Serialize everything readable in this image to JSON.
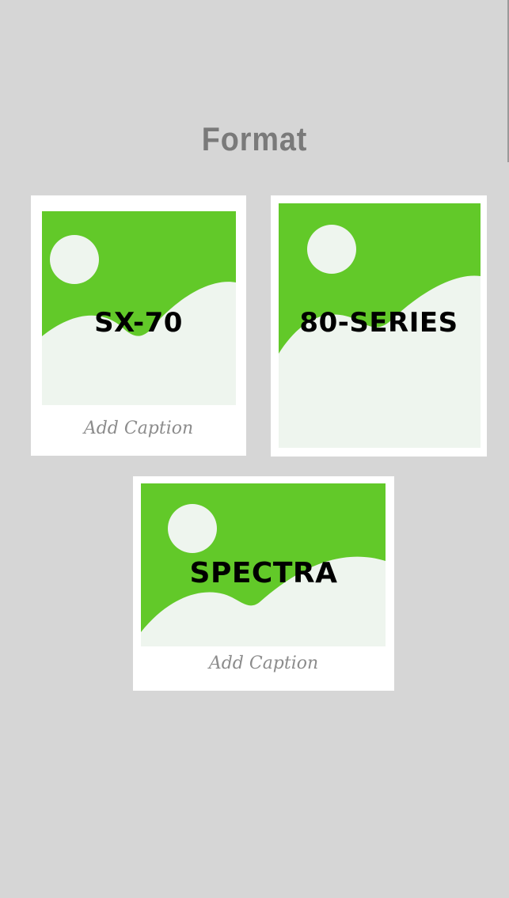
{
  "page": {
    "title": "Format"
  },
  "colors": {
    "background": "#d6d6d6",
    "card": "#ffffff",
    "photo_sky": "#62c929",
    "photo_hills": "#eef5ee",
    "title_text": "#7a7a7a",
    "caption_text": "#8c8c8c",
    "label_text": "#000000"
  },
  "formats": [
    {
      "label": "SX-70",
      "caption": "Add Caption",
      "icon": "image-placeholder-icon"
    },
    {
      "label": "80-SERIES",
      "caption": "",
      "icon": "image-placeholder-icon"
    },
    {
      "label": "SPECTRA",
      "caption": "Add Caption",
      "icon": "image-placeholder-icon"
    }
  ]
}
